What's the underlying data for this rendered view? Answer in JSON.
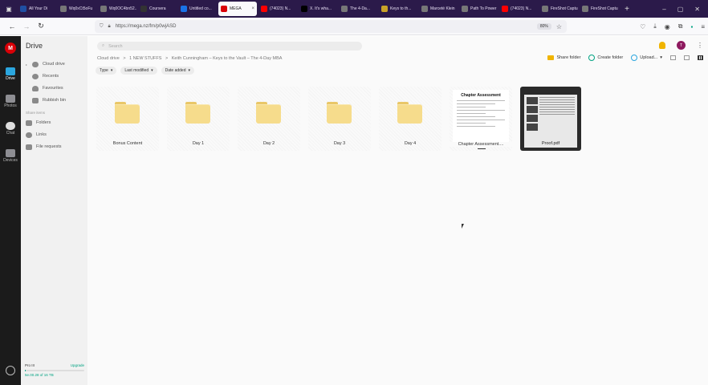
{
  "browser": {
    "tabs": [
      {
        "label": "All Your Di",
        "icon": "xc-icon",
        "color": "#1f4fa3"
      },
      {
        "label": "Wq0xCt5oFu",
        "icon": "page-icon",
        "color": "#777777"
      },
      {
        "label": "Wq0OC4bn52...",
        "icon": "page-icon",
        "color": "#777777"
      },
      {
        "label": "Coursera",
        "icon": "coursera-icon",
        "color": "#333333"
      },
      {
        "label": "Untitled co...",
        "icon": "blue-app-icon",
        "color": "#1a73e8"
      },
      {
        "label": "MEGA",
        "icon": "mega-icon",
        "color": "#d90007",
        "active": true
      },
      {
        "label": "(74023) N...",
        "icon": "youtube-icon",
        "color": "#ff0000"
      },
      {
        "label": "X. It's wha...",
        "icon": "x-icon",
        "color": "#000000"
      },
      {
        "label": "The 4-Da...",
        "icon": "page-icon",
        "color": "#777777"
      },
      {
        "label": "Keys to th...",
        "icon": "image-icon",
        "color": "#c9a227"
      },
      {
        "label": "Marceté Klein",
        "icon": "page-icon",
        "color": "#777777"
      },
      {
        "label": "Path To Power",
        "icon": "page-icon",
        "color": "#777777"
      },
      {
        "label": "(74023) N...",
        "icon": "youtube-icon",
        "color": "#ff0000"
      },
      {
        "label": "FireShot Captu...",
        "icon": "page-icon",
        "color": "#777777"
      },
      {
        "label": "FireShot Captu...",
        "icon": "page-icon",
        "color": "#777777"
      }
    ],
    "url": "https://mega.nz/fm/p0wjASD",
    "zoom": "80%"
  },
  "rail": {
    "logo": "M",
    "items": [
      {
        "label": "Drive",
        "active": true
      },
      {
        "label": "Photos"
      },
      {
        "label": "Chat"
      },
      {
        "label": "Devices"
      }
    ]
  },
  "sidebar": {
    "title": "Drive",
    "items": [
      {
        "label": "Cloud drive"
      },
      {
        "label": "Recents"
      },
      {
        "label": "Favourites"
      },
      {
        "label": "Rubbish bin"
      }
    ],
    "shared_title": "Share items",
    "shared_items": [
      {
        "label": "Folders"
      },
      {
        "label": "Links"
      },
      {
        "label": "File requests"
      }
    ],
    "storage": {
      "plan": "Pro III",
      "upgrade": "Upgrade",
      "used_text": "5e.00.28 of 16 TB",
      "used_fraction": 0.02
    }
  },
  "main": {
    "search_placeholder": "Search",
    "avatar_initial": "T",
    "breadcrumb": [
      "Cloud drive",
      ">",
      "1 NEW STUFFS",
      ">",
      "Keith Cunningham – Keys to the Vault – The 4-Day MBA"
    ],
    "actions": {
      "share_folder": "Share folder",
      "create_folder": "Create folder",
      "upload": "Upload..."
    },
    "filters": [
      "Type",
      "Last modified",
      "Date added"
    ],
    "items": [
      {
        "name": "Bonus Content",
        "kind": "folder"
      },
      {
        "name": "Day 1",
        "kind": "folder"
      },
      {
        "name": "Day 2",
        "kind": "folder"
      },
      {
        "name": "Day 3",
        "kind": "folder"
      },
      {
        "name": "Day 4",
        "kind": "folder"
      },
      {
        "name": "Chapter Assessment....",
        "kind": "doc",
        "thumb_title": "Chapter Assessment"
      },
      {
        "name": "Proof.pdf",
        "kind": "pdf"
      }
    ]
  }
}
